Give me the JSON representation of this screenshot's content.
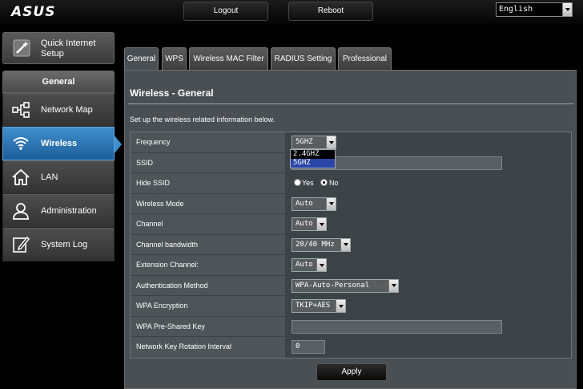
{
  "brand": "ASUS",
  "header": {
    "logout_label": "Logout",
    "reboot_label": "Reboot",
    "language": "English"
  },
  "sidebar": {
    "quick_setup_label": "Quick Internet Setup",
    "section_label": "General",
    "items": [
      {
        "label": "Network Map",
        "icon": "network-map-icon",
        "active": false
      },
      {
        "label": "Wireless",
        "icon": "wifi-icon",
        "active": true
      },
      {
        "label": "LAN",
        "icon": "home-icon",
        "active": false
      },
      {
        "label": "Administration",
        "icon": "user-icon",
        "active": false
      },
      {
        "label": "System Log",
        "icon": "edit-icon",
        "active": false
      }
    ]
  },
  "tabs": [
    {
      "label": "General",
      "active": true
    },
    {
      "label": "WPS",
      "active": false
    },
    {
      "label": "Wireless MAC Filter",
      "active": false
    },
    {
      "label": "RADIUS Setting",
      "active": false
    },
    {
      "label": "Professional",
      "active": false
    }
  ],
  "main": {
    "title": "Wireless - General",
    "description": "Set up the wireless related information below.",
    "fields": {
      "frequency": {
        "label": "Frequency",
        "value": "5GHZ",
        "options": [
          "2.4GHZ",
          "5GHZ"
        ]
      },
      "ssid": {
        "label": "SSID",
        "value": ""
      },
      "hide_ssid": {
        "label": "Hide SSID",
        "yes": "Yes",
        "no": "No",
        "selected": "No"
      },
      "wireless_mode": {
        "label": "Wireless Mode",
        "value": "Auto"
      },
      "channel": {
        "label": "Channel",
        "value": "Auto"
      },
      "channel_bandwidth": {
        "label": "Channel bandwidth",
        "value": "20/40 MHz"
      },
      "extension_channel": {
        "label": "Extension Channel:",
        "value": "Auto"
      },
      "auth_method": {
        "label": "Authentication Method",
        "value": "WPA-Auto-Personal"
      },
      "wpa_encryption": {
        "label": "WPA Encryption",
        "value": "TKIP+AES"
      },
      "wpa_psk": {
        "label": "WPA Pre-Shared Key",
        "value": ""
      },
      "key_rotation": {
        "label": "Network Key Rotation Interval",
        "value": "0"
      }
    },
    "apply_label": "Apply"
  },
  "colors": {
    "accent": "#3f8fcc",
    "panel": "#4a4f53",
    "dropdown_highlight": "#2946a8"
  }
}
